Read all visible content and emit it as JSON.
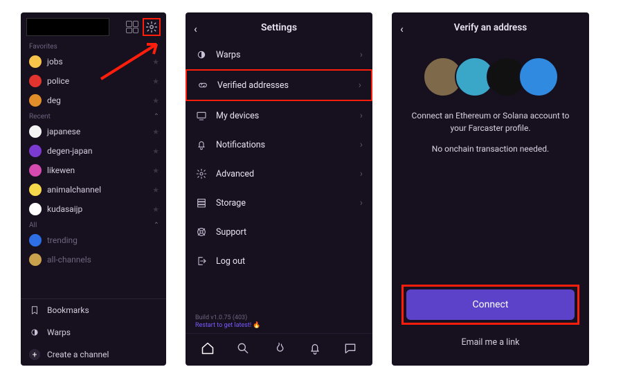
{
  "panel1": {
    "sections": {
      "favorites": {
        "label": "Favorites"
      },
      "recent": {
        "label": "Recent"
      },
      "all": {
        "label": "All"
      }
    },
    "favorites": [
      {
        "label": "jobs",
        "color": "#F6C44B"
      },
      {
        "label": "police",
        "color": "#E2342E"
      },
      {
        "label": "deg",
        "color": "#E28F2A"
      }
    ],
    "recent": [
      {
        "label": "japanese",
        "color": "#F4F4F4"
      },
      {
        "label": "degen-japan",
        "color": "#7B3BD0"
      },
      {
        "label": "likewen",
        "color": "#D64BB0"
      },
      {
        "label": "animalchannel",
        "color": "#F6D84B"
      },
      {
        "label": "kudasaijp",
        "color": "#FFFFFF"
      }
    ],
    "all": [
      {
        "label": "trending",
        "color": "#2E6FE5"
      },
      {
        "label": "all-channels",
        "color": "#C9A24C"
      }
    ],
    "bottom": {
      "bookmarks": "Bookmarks",
      "warps": "Warps",
      "create": "Create a channel"
    }
  },
  "panel2": {
    "title": "Settings",
    "items": [
      {
        "key": "warps",
        "label": "Warps",
        "icon": "half-circle-icon",
        "caret": true
      },
      {
        "key": "verified",
        "label": "Verified addresses",
        "icon": "link-icon",
        "caret": true,
        "highlight": true
      },
      {
        "key": "devices",
        "label": "My devices",
        "icon": "monitor-icon",
        "caret": true
      },
      {
        "key": "notif",
        "label": "Notifications",
        "icon": "bell-icon",
        "caret": true
      },
      {
        "key": "advanced",
        "label": "Advanced",
        "icon": "gear-icon",
        "caret": true
      },
      {
        "key": "storage",
        "label": "Storage",
        "icon": "storage-icon",
        "caret": true
      },
      {
        "key": "support",
        "label": "Support",
        "icon": "life-ring-icon",
        "caret": false
      },
      {
        "key": "logout",
        "label": "Log out",
        "icon": "logout-icon",
        "caret": false
      }
    ],
    "build_line": "Build v1.0.75 (403)",
    "restart_line": "Restart to get latest! 🔥"
  },
  "panel3": {
    "title": "Verify an address",
    "body_line1": "Connect an Ethereum or Solana account to your Farcaster profile.",
    "body_line2": "No onchain transaction needed.",
    "connect": "Connect",
    "email": "Email me a link",
    "avatars": [
      "#7E6A4B",
      "#3AA7C9",
      "#111111",
      "#2F8AE0"
    ]
  }
}
